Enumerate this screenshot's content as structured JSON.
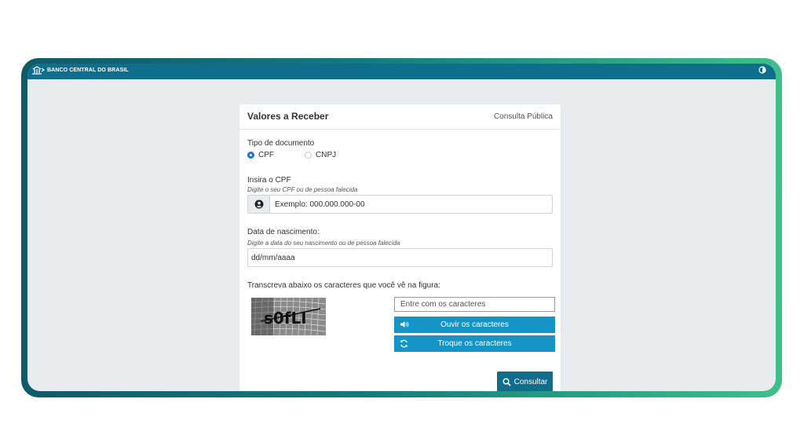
{
  "header": {
    "brand": "BANCO CENTRAL DO BRASIL",
    "contrast_icon": "contrast-icon"
  },
  "card": {
    "title": "Valores a Receber",
    "subtitle": "Consulta Pública"
  },
  "doc_type": {
    "label": "Tipo de documento",
    "options": [
      "CPF",
      "CNPJ"
    ],
    "selected": "CPF"
  },
  "cpf": {
    "label": "Insira o CPF",
    "hint": "Digite o seu CPF ou de pessoa falecida",
    "placeholder": "Exemplo: 000.000.000-00",
    "icon": "user-icon"
  },
  "birth": {
    "label": "Data de nascimento:",
    "hint": "Digite a data do seu nascimento ou de pessoa falecida",
    "placeholder": "dd/mm/aaaa"
  },
  "captcha": {
    "label": "Transcreva abaixo os caracteres que você vê na figura:",
    "image_text": "s0fLI",
    "placeholder": "Entre com os caracteres",
    "listen_label": "Ouvir os caracteres",
    "refresh_label": "Troque os caracteres"
  },
  "submit_label": "Consultar",
  "colors": {
    "topbar": "#0e6e8c",
    "button": "#1594c8",
    "submit": "#0e6e8c",
    "radio": "#1a73e8"
  }
}
